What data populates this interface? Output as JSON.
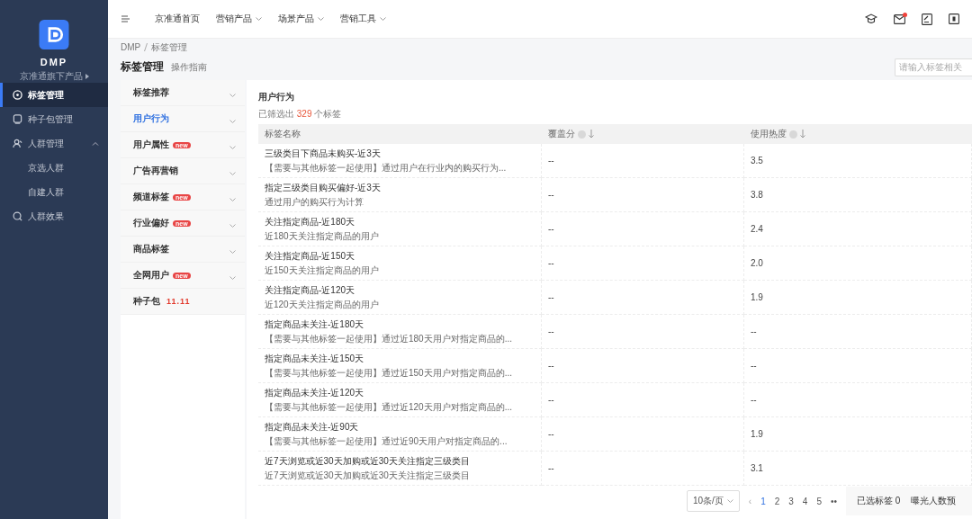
{
  "sidebar": {
    "app_name": "DMP",
    "subtitle": "京准通旗下产品",
    "items": [
      {
        "label": "标签管理",
        "selected": true
      },
      {
        "label": "种子包管理",
        "selected": false
      },
      {
        "label": "人群管理",
        "selected": false,
        "expanded": true,
        "children": [
          {
            "label": "京选人群",
            "selected": false
          },
          {
            "label": "自建人群",
            "selected": false
          }
        ]
      },
      {
        "label": "人群效果",
        "selected": false
      }
    ]
  },
  "top_nav": {
    "items": [
      {
        "label": "京准通首页",
        "dropdown": false
      },
      {
        "label": "营销产品",
        "dropdown": true
      },
      {
        "label": "场景产品",
        "dropdown": true
      },
      {
        "label": "营销工具",
        "dropdown": true
      }
    ],
    "mail_unread": true
  },
  "breadcrumb": [
    "DMP",
    "标签管理"
  ],
  "page": {
    "title": "标签管理",
    "guide_link": "操作指南",
    "search": {
      "placeholder": "请输入标签相关"
    }
  },
  "categories": [
    {
      "label": "标签推荐",
      "selected": false,
      "expandable": true
    },
    {
      "label": "用户行为",
      "selected": true,
      "expandable": true
    },
    {
      "label": "用户属性",
      "selected": false,
      "expandable": true,
      "badge": {
        "kind": "new",
        "text": "new"
      }
    },
    {
      "label": "广告再营销",
      "selected": false,
      "expandable": true
    },
    {
      "label": "频道标签",
      "selected": false,
      "expandable": true,
      "badge": {
        "kind": "new",
        "text": "new"
      }
    },
    {
      "label": "行业偏好",
      "selected": false,
      "expandable": true,
      "badge": {
        "kind": "new",
        "text": "new"
      }
    },
    {
      "label": "商品标签",
      "selected": false,
      "expandable": true
    },
    {
      "label": "全网用户",
      "selected": false,
      "expandable": true,
      "badge": {
        "kind": "new",
        "text": "new"
      }
    },
    {
      "label": "种子包",
      "selected": false,
      "expandable": false,
      "badge": {
        "kind": "festival",
        "text": "11.11"
      }
    }
  ],
  "table": {
    "title": "用户行为",
    "summary_prefix": "已筛选出",
    "count": "329",
    "summary_suffix": "个标签",
    "columns": [
      {
        "label": "标签名称",
        "sortable": false
      },
      {
        "label": "覆盖分",
        "sortable": true
      },
      {
        "label": "使用热度",
        "sortable": true
      }
    ],
    "rows": [
      {
        "name": "三级类目下商品未购买-近3天",
        "desc": "【需要与其他标签一起使用】通过用户在行业内的购买行为...",
        "coverage": "--",
        "heat": "3.5"
      },
      {
        "name": "指定三级类目购买偏好-近3天",
        "desc": "通过用户的购买行为计算",
        "coverage": "--",
        "heat": "3.8"
      },
      {
        "name": "关注指定商品-近180天",
        "desc": "近180天关注指定商品的用户",
        "coverage": "--",
        "heat": "2.4"
      },
      {
        "name": "关注指定商品-近150天",
        "desc": "近150天关注指定商品的用户",
        "coverage": "--",
        "heat": "2.0"
      },
      {
        "name": "关注指定商品-近120天",
        "desc": "近120天关注指定商品的用户",
        "coverage": "--",
        "heat": "1.9"
      },
      {
        "name": "指定商品未关注-近180天",
        "desc": "【需要与其他标签一起使用】通过近180天用户对指定商品的...",
        "coverage": "--",
        "heat": "--"
      },
      {
        "name": "指定商品未关注-近150天",
        "desc": "【需要与其他标签一起使用】通过近150天用户对指定商品的...",
        "coverage": "--",
        "heat": "--"
      },
      {
        "name": "指定商品未关注-近120天",
        "desc": "【需要与其他标签一起使用】通过近120天用户对指定商品的...",
        "coverage": "--",
        "heat": "--"
      },
      {
        "name": "指定商品未关注-近90天",
        "desc": "【需要与其他标签一起使用】通过近90天用户对指定商品的...",
        "coverage": "--",
        "heat": "1.9"
      },
      {
        "name": "近7天浏览或近30天加购或近30天关注指定三级类目",
        "desc": "近7天浏览或近30天加购或近30天关注指定三级类目",
        "coverage": "--",
        "heat": "3.1"
      }
    ]
  },
  "pagination": {
    "page_size": "10条/页",
    "prev": "‹",
    "pages": [
      {
        "label": "1",
        "selected": true
      },
      {
        "label": "2",
        "selected": false
      },
      {
        "label": "3",
        "selected": false
      },
      {
        "label": "4",
        "selected": false
      },
      {
        "label": "5",
        "selected": false
      }
    ],
    "more": "••"
  },
  "footer": {
    "selected_label": "已选标签",
    "selected_count": "0",
    "exposure_label": "曝光人数预"
  }
}
